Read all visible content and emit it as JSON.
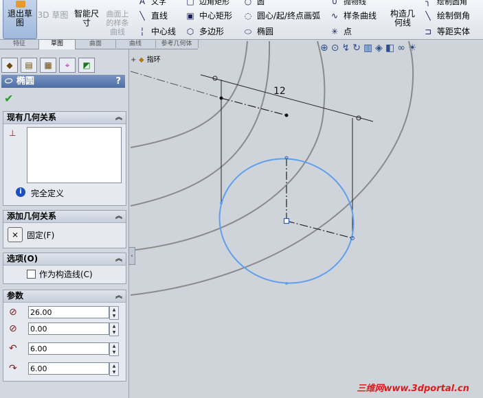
{
  "ribbon": {
    "exit_sketch": "退出草图",
    "sketch_3d": "3D 草图",
    "smart_dim": "智能尺寸",
    "surface_spline": "曲面上的样条曲线",
    "col1": [
      "直线",
      "中心线"
    ],
    "col2": [
      "中心矩形",
      "多边形"
    ],
    "col3": [
      "圆心/起/终点画弧",
      "椭圆"
    ],
    "col4": [
      "样条曲线",
      "点"
    ],
    "construct_geo": "构造几何线",
    "col5": [
      "绘制倒角",
      "等距实体"
    ],
    "partial_top": [
      "文字",
      "边角矩形",
      "圆",
      "抛物线",
      "绘制圆角"
    ]
  },
  "cmd_tabs": [
    "特征",
    "草图",
    "曲面",
    "曲线",
    "参考几何体"
  ],
  "active_tab": "草图",
  "panel": {
    "title": "椭圆",
    "help": "?",
    "group_existing": "现有几何关系",
    "status": "完全定义",
    "group_add": "添加几何关系",
    "fix_label": "固定(F)",
    "group_options": "选项(O)",
    "construction_label": "作为构造线(C)",
    "group_params": "参数",
    "params": [
      "26.00",
      "0.00",
      "6.00",
      "6.00"
    ]
  },
  "tree": {
    "item": "指环"
  },
  "dimension": "12",
  "watermark": "三维网www.3dportal.cn",
  "colors": {
    "ellipse": "#5ea0ee",
    "accent": "#4e6ea6",
    "arc": "#8a8a8a"
  }
}
